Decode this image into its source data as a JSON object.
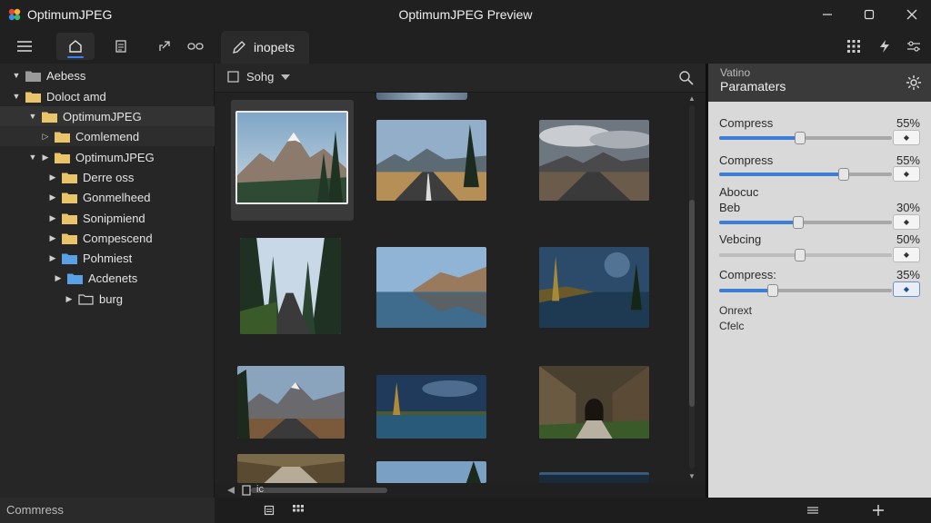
{
  "window": {
    "app_name": "OptimumJPEG",
    "title": "OptimumJPEG Preview"
  },
  "toolbar": {
    "left_buttons": [
      "list-icon",
      "home-icon",
      "document-icon",
      "share-icon",
      "link-icon"
    ],
    "active_button": "home-icon",
    "tab_label": "inopets",
    "right_buttons": [
      "grid-icon",
      "lightning-icon",
      "settings-sliders-icon"
    ]
  },
  "sidebar": {
    "tree": [
      {
        "label": "Aebess",
        "expanded": true,
        "level": 0,
        "icon": "folder-gray"
      },
      {
        "label": "Doloct amd",
        "expanded": true,
        "level": 0,
        "icon": "folder-yellow"
      },
      {
        "label": "OptimumJPEG",
        "expanded": true,
        "level": 1,
        "icon": "folder-yellow",
        "selected": true
      },
      {
        "label": "Comlemend",
        "expanded": false,
        "level": 2,
        "icon": "folder-yellow",
        "hover": true
      },
      {
        "label": "OptimumJPEG",
        "expanded": true,
        "level": 2,
        "icon": "folder-yellow"
      },
      {
        "label": "Derre oss",
        "expanded": false,
        "level": 3,
        "icon": "folder-yellow"
      },
      {
        "label": "Gonmelheed",
        "expanded": false,
        "level": 3,
        "icon": "folder-yellow"
      },
      {
        "label": "Sonipmiend",
        "expanded": false,
        "level": 3,
        "icon": "folder-yellow"
      },
      {
        "label": "Compescend",
        "expanded": false,
        "level": 3,
        "icon": "folder-yellow"
      },
      {
        "label": "Pohmiest",
        "expanded": false,
        "level": 3,
        "icon": "folder-blue"
      },
      {
        "label": "Acdenets",
        "expanded": false,
        "level": 3,
        "icon": "folder-blue"
      },
      {
        "label": "burg",
        "expanded": false,
        "level": 4,
        "icon": "folder-outline"
      }
    ]
  },
  "gallery": {
    "sort_label": "Sohg",
    "scroll_label": "ic",
    "thumbnails": [
      {
        "scene": "mountain-forest",
        "selected": true
      },
      {
        "scene": "road-pine"
      },
      {
        "scene": "road-clouds"
      },
      {
        "scene": "forest-road"
      },
      {
        "scene": "lake-reflection"
      },
      {
        "scene": "tree-lake"
      },
      {
        "scene": "mountain-road"
      },
      {
        "scene": "palm-reflection"
      },
      {
        "scene": "stone-arch"
      },
      {
        "scene": "covered-path"
      },
      {
        "scene": "sky-tree"
      },
      {
        "scene": "dark-horizon"
      }
    ]
  },
  "params": {
    "kicker": "Vatino",
    "title": "Paramaters",
    "rows": [
      {
        "label": "Compress",
        "value": "55%",
        "level": 0.47
      },
      {
        "label": "Compress",
        "value": "55%",
        "level": 0.72
      },
      {
        "label": "Abocuc",
        "value": "",
        "level": null
      },
      {
        "label": "Beb",
        "value": "30%",
        "level": 0.46
      },
      {
        "label": "Vebcing",
        "value": "50%",
        "level": 0.47
      },
      {
        "label": "Compress:",
        "value": "35%",
        "level": 0.31
      }
    ],
    "note_line1": "Onrext",
    "note_line2": "Cfelc"
  },
  "status": {
    "left_text": "Commress"
  },
  "colors": {
    "accent": "#3d7ed6",
    "panel_light": "#d9d9d9",
    "folder_yellow": "#e9c46a",
    "folder_blue": "#5aa0e6"
  }
}
